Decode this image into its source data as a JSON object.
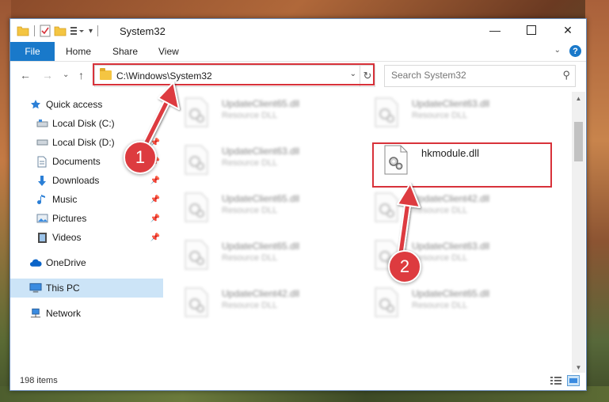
{
  "window": {
    "title": "System32"
  },
  "ribbon": {
    "tabs": [
      {
        "label": "File"
      },
      {
        "label": "Home"
      },
      {
        "label": "Share"
      },
      {
        "label": "View"
      }
    ],
    "help_label": "?"
  },
  "address": {
    "path": "C:\\Windows\\System32"
  },
  "search": {
    "placeholder": "Search System32"
  },
  "sidebar": {
    "items": [
      {
        "label": "Quick access",
        "icon": "star-icon",
        "pinned": false
      },
      {
        "label": "Local Disk (C:)",
        "icon": "drive-icon",
        "pinned": false
      },
      {
        "label": "Local Disk (D:)",
        "icon": "drive-icon",
        "pinned": true
      },
      {
        "label": "Documents",
        "icon": "document-icon",
        "pinned": true
      },
      {
        "label": "Downloads",
        "icon": "download-icon",
        "pinned": true
      },
      {
        "label": "Music",
        "icon": "music-icon",
        "pinned": true
      },
      {
        "label": "Pictures",
        "icon": "pictures-icon",
        "pinned": true
      },
      {
        "label": "Videos",
        "icon": "video-icon",
        "pinned": true
      },
      {
        "label": "OneDrive",
        "icon": "cloud-icon",
        "pinned": false
      },
      {
        "label": "This PC",
        "icon": "computer-icon",
        "pinned": false,
        "selected": true
      },
      {
        "label": "Network",
        "icon": "network-icon",
        "pinned": false
      }
    ]
  },
  "files": [
    {
      "name": "UpdateClient65.dll",
      "type": "Resource DLL",
      "blurred": true
    },
    {
      "name": "UpdateClient63.dll",
      "type": "Resource DLL",
      "blurred": true
    },
    {
      "name": "UpdateClient63.dll",
      "type": "Resource DLL",
      "blurred": true
    },
    {
      "name": "hkmodule.dll",
      "type": "",
      "blurred": false,
      "highlighted": true
    },
    {
      "name": "UpdateClient65.dll",
      "type": "Resource DLL",
      "blurred": true
    },
    {
      "name": "UpdateClient42.dll",
      "type": "Resource DLL",
      "blurred": true
    },
    {
      "name": "UpdateClient65.dll",
      "type": "Resource DLL",
      "blurred": true
    },
    {
      "name": "UpdateClient63.dll",
      "type": "Resource DLL",
      "blurred": true
    },
    {
      "name": "UpdateClient42.dll",
      "type": "Resource DLL",
      "blurred": true
    },
    {
      "name": "UpdateClient65.dll",
      "type": "Resource DLL",
      "blurred": true
    }
  ],
  "status": {
    "item_count": "198 items"
  },
  "annotations": {
    "step1": "1",
    "step2": "2",
    "highlight_color": "#d8323a",
    "badge_color": "#dd3b3f"
  },
  "colors": {
    "accent": "#1979ca",
    "selection": "#cce4f7"
  }
}
